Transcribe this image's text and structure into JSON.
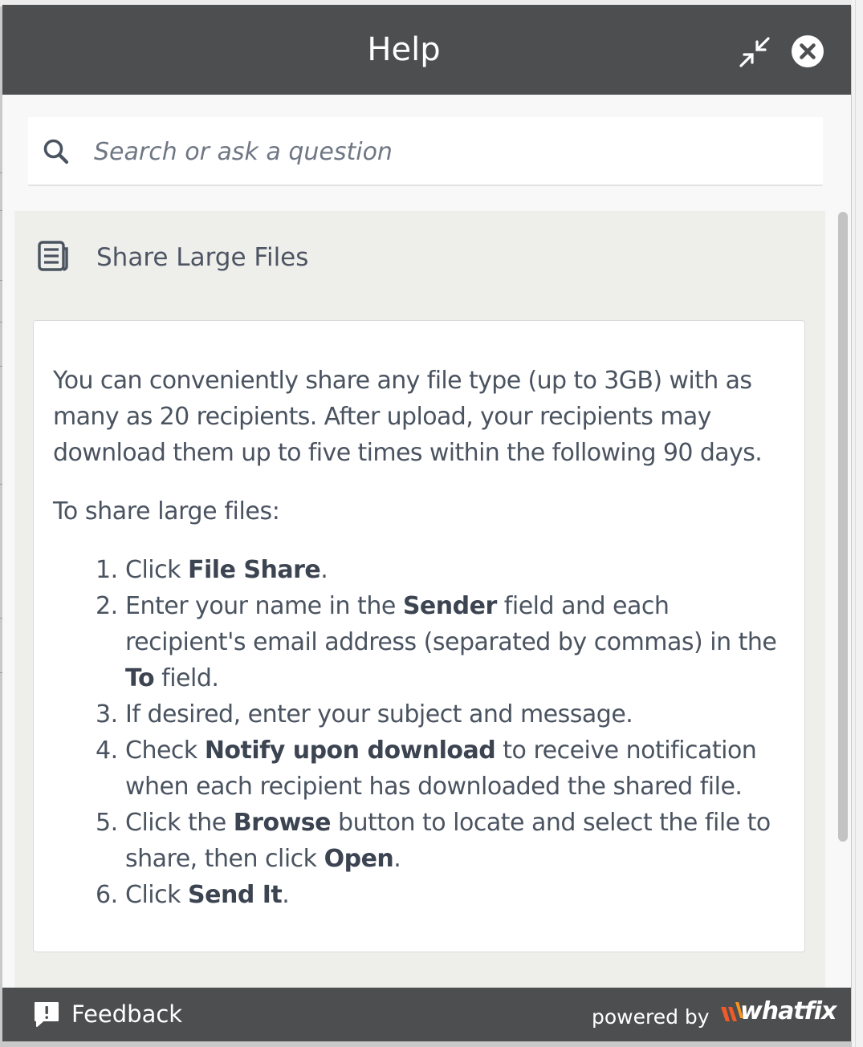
{
  "header": {
    "title": "Help",
    "minimize_icon": "minimize-arrows-icon",
    "close_icon": "close-circle-icon"
  },
  "search": {
    "placeholder": "Search or ask a question",
    "icon": "search-icon"
  },
  "article": {
    "icon": "article-icon",
    "title": "Share Large Files",
    "intro": "You can conveniently share any file type (up to 3GB) with as many as 20 recipients. After upload, your recipients may download them up to five times within the following 90 days.",
    "lead_in": "To share large files:",
    "steps": [
      {
        "num": "1.",
        "parts": [
          "Click ",
          "File Share",
          "."
        ]
      },
      {
        "num": "2.",
        "parts": [
          "Enter your name in the ",
          "Sender",
          " field and each recipient's email address (separated by commas) in the ",
          "To",
          " field."
        ]
      },
      {
        "num": "3.",
        "parts": [
          "If desired, enter your subject and message."
        ]
      },
      {
        "num": "4.",
        "parts": [
          "Check ",
          "Notify upon download",
          " to receive notification when each recipient has downloaded the shared file."
        ]
      },
      {
        "num": "5.",
        "parts": [
          "Click the ",
          "Browse",
          " button to locate and select the file to share, then click ",
          "Open",
          "."
        ]
      },
      {
        "num": "6.",
        "parts": [
          "Click ",
          "Send It",
          "."
        ]
      }
    ]
  },
  "footer": {
    "feedback_label": "Feedback",
    "feedback_icon": "feedback-icon",
    "powered_by": "powered by",
    "brand_name": "whatfix",
    "brand_color": "#f05a28"
  },
  "colors": {
    "header_bg": "#4d4e50",
    "content_bg": "#eeeeeb",
    "text": "#4a5360"
  }
}
